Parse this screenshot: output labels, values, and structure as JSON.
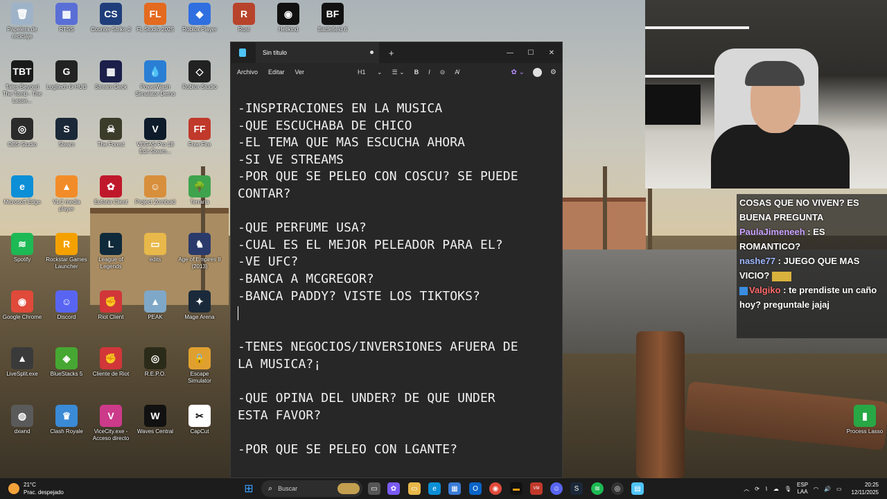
{
  "desktop": {
    "icons": [
      {
        "label": "Papelera de reciclaje",
        "color": "#9fb3c8",
        "glyph": "🗑"
      },
      {
        "label": "RTSS",
        "color": "#5a6fd6",
        "glyph": "▦"
      },
      {
        "label": "Counter Strike 2",
        "color": "#1f3d7a",
        "glyph": "CS"
      },
      {
        "label": "FL Studio 2025",
        "color": "#e36a1e",
        "glyph": "FL"
      },
      {
        "label": "Roblox Player",
        "color": "#2f6fe0",
        "glyph": "◆"
      },
      {
        "label": "Rust",
        "color": "#b8432b",
        "glyph": "R"
      },
      {
        "label": "Hellkind",
        "color": "#111111",
        "glyph": "◉"
      },
      {
        "label": "Battlefield 6",
        "color": "#111111",
        "glyph": "BF"
      },
      {
        "label": "Tales Beyond The Tomb - The Lasse...",
        "color": "#1a1a1a",
        "glyph": "TBT"
      },
      {
        "label": "Logitech G HUB",
        "color": "#222222",
        "glyph": "G"
      },
      {
        "label": "Stream Deck",
        "color": "#1b1f4a",
        "glyph": "▦"
      },
      {
        "label": "PowerWash Simulator Demo",
        "color": "#2a7fd4",
        "glyph": "💧"
      },
      {
        "label": "Roblox Studio",
        "color": "#222222",
        "glyph": "◇"
      },
      {
        "label": "OBS Studio",
        "color": "#2b2b2b",
        "glyph": "◎"
      },
      {
        "label": "Steam",
        "color": "#1b2838",
        "glyph": "S"
      },
      {
        "label": "The Forest",
        "color": "#3b3d2a",
        "glyph": "☠"
      },
      {
        "label": "VEGAS Pro 18 Edit Steam...",
        "color": "#0d1b2a",
        "glyph": "V"
      },
      {
        "label": "Free Fire",
        "color": "#c0392b",
        "glyph": "FF"
      },
      {
        "label": "Microsoft Edge",
        "color": "#0c8fd6",
        "glyph": "e"
      },
      {
        "label": "VLC media player",
        "color": "#f28c28",
        "glyph": "▲"
      },
      {
        "label": "Euforia Client",
        "color": "#c0182b",
        "glyph": "✿"
      },
      {
        "label": "Project Zomboid",
        "color": "#d88f3c",
        "glyph": "☺"
      },
      {
        "label": "Terraria",
        "color": "#3fa34d",
        "glyph": "🌳"
      },
      {
        "label": "Spotify",
        "color": "#1db954",
        "glyph": "≋"
      },
      {
        "label": "Rockstar Games Launcher",
        "color": "#f4a100",
        "glyph": "R"
      },
      {
        "label": "League of Legends",
        "color": "#0f2a3a",
        "glyph": "L"
      },
      {
        "label": "edits",
        "color": "#e8b84a",
        "glyph": "▭"
      },
      {
        "label": "Age of Empires II (2013)",
        "color": "#2a3a6a",
        "glyph": "♞"
      },
      {
        "label": "Google Chrome",
        "color": "#e04a3a",
        "glyph": "◉"
      },
      {
        "label": "Discord",
        "color": "#5865f2",
        "glyph": "☺"
      },
      {
        "label": "Riot Client",
        "color": "#d13639",
        "glyph": "✊"
      },
      {
        "label": "PEAK",
        "color": "#7fa8c8",
        "glyph": "▲"
      },
      {
        "label": "Mage Arena",
        "color": "#1a2a3a",
        "glyph": "✦"
      },
      {
        "label": "LiveSplit.exe",
        "color": "#3a3a3a",
        "glyph": "▲"
      },
      {
        "label": "BlueStacks 5",
        "color": "#46a832",
        "glyph": "◈"
      },
      {
        "label": "Cliente de Riot",
        "color": "#d13639",
        "glyph": "✊"
      },
      {
        "label": "R.E.P.O.",
        "color": "#2b2b1a",
        "glyph": "◎"
      },
      {
        "label": "Escape Simulator",
        "color": "#e0a030",
        "glyph": "🔒"
      },
      {
        "label": "dxwnd",
        "color": "#5a5a5a",
        "glyph": "◍"
      },
      {
        "label": "Clash Royale",
        "color": "#3a8ad6",
        "glyph": "♛"
      },
      {
        "label": "ViceCity.exe - Acceso directo",
        "color": "#cc3a8a",
        "glyph": "V"
      },
      {
        "label": "Waves Central",
        "color": "#111111",
        "glyph": "W"
      },
      {
        "label": "CapCut",
        "color": "#ffffff",
        "glyph": "✂"
      },
      {
        "label": "Process Lasso",
        "color": "#28a745",
        "glyph": "▮"
      }
    ]
  },
  "notepad": {
    "tab_title": "Sin título",
    "menu": [
      "Archivo",
      "Editar",
      "Ver"
    ],
    "heading_tool": "H1",
    "lines": [
      "-INSPIRACIONES EN LA MUSICA",
      "-QUE ESCUCHABA DE CHICO",
      "-EL TEMA QUE MAS ESCUCHA AHORA",
      "-SI VE STREAMS",
      "-POR QUE SE PELEO CON COSCU? SE PUEDE",
      "CONTAR?",
      "",
      "-QUE PERFUME USA?",
      "-CUAL ES EL MEJOR PELEADOR PARA EL?",
      "-VE UFC?",
      "-BANCA A MCGREGOR?",
      "-BANCA PADDY? VISTE LOS TIKTOKS?",
      "",
      "",
      "-TENES NEGOCIOS/INVERSIONES AFUERA DE",
      "LA MUSICA?¡",
      "",
      "-QUE OPINA DEL UNDER? DE QUE UNDER",
      "ESTA FAVOR?",
      "",
      "-POR QUE SE PELEO CON LGANTE?"
    ]
  },
  "chat": {
    "messages": [
      {
        "user": "",
        "user_color": "#ffffff",
        "text": "COSAS QUE NO VIVEN? ES BUENA PREGUNTA"
      },
      {
        "user": "PaulaJimeneeh",
        "user_color": "#c9a3ff",
        "text": ": ES ROMANTICO?"
      },
      {
        "user": "nashe77",
        "user_color": "#a0b8ff",
        "text": ": JUEGO QUE MAS VICIO?"
      },
      {
        "user": "Valgiko",
        "user_color": "#ff6a6a",
        "text": ": te prendiste un caño hoy? preguntale jajaj"
      }
    ]
  },
  "taskbar": {
    "weather_temp": "21°C",
    "weather_desc": "Prac. despejado",
    "search_placeholder": "Buscar",
    "lang_line1": "ESP",
    "lang_line2": "LAA",
    "time": "20:25",
    "date": "12/11/2025"
  }
}
